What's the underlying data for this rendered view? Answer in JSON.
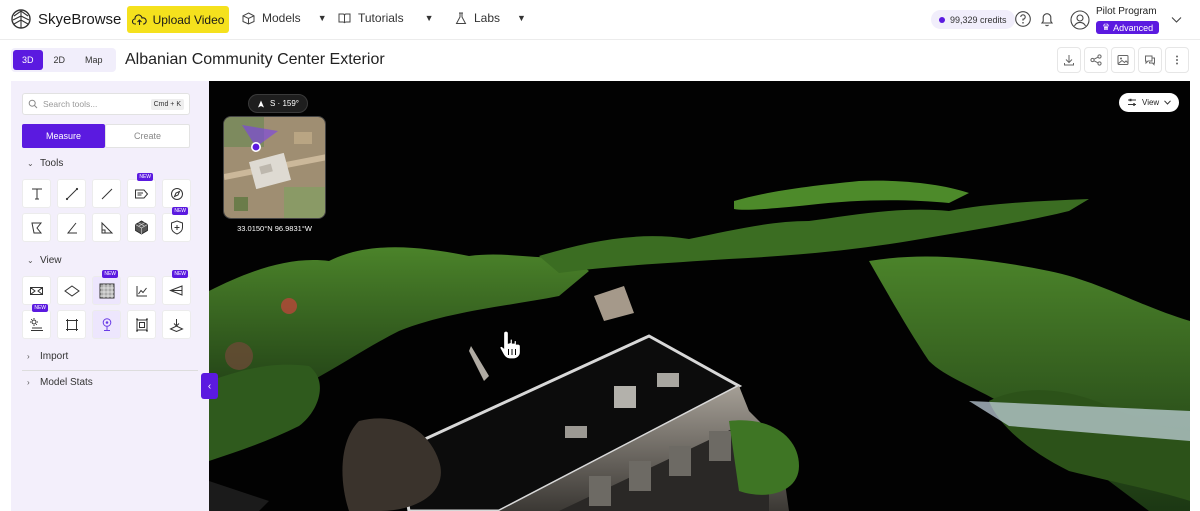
{
  "brand": {
    "name": "SkyeBrowse"
  },
  "nav": {
    "upload_label": "Upload Video",
    "models_label": "Models",
    "tutorials_label": "Tutorials",
    "labs_label": "Labs"
  },
  "account": {
    "credits": "99,329 credits",
    "user_name": "Pilot Program",
    "plan": "Advanced"
  },
  "toolbar": {
    "view_tabs": [
      "3D",
      "2D",
      "Map"
    ],
    "active_tab": "3D",
    "title": "Albanian Community Center Exterior"
  },
  "sidebar": {
    "search_placeholder": "Search tools...",
    "search_shortcut": "Cmd + K",
    "mode_measure": "Measure",
    "mode_create": "Create",
    "tools_label": "Tools",
    "view_label": "View",
    "import_label": "Import",
    "model_stats_label": "Model Stats",
    "new_tag": "NEW"
  },
  "viewer": {
    "heading": "S · 159°",
    "coordinates": "33.0150°N 96.9831°W",
    "view_menu_label": "View"
  },
  "colors": {
    "accent": "#5b1ae0",
    "upload": "#f5e11d",
    "sidebar_bg": "#f3effb",
    "viewport_bg": "#020202"
  },
  "icons": {
    "tools_row1": [
      "text-icon",
      "line-measure-icon",
      "slope-line-icon",
      "annotation-icon",
      "compass-icon"
    ],
    "tools_row2": [
      "polygon-icon",
      "angle-icon",
      "right-triangle-icon",
      "volume-icon",
      "shield-plus-icon"
    ],
    "view_row1": [
      "cross-section-icon",
      "plane-icon",
      "texture-icon",
      "elevation-chart-icon",
      "camera-cone-icon"
    ],
    "view_row2": [
      "lighting-icon",
      "crop-box-icon",
      "pin-icon",
      "bounding-box-icon",
      "ground-icon"
    ]
  }
}
